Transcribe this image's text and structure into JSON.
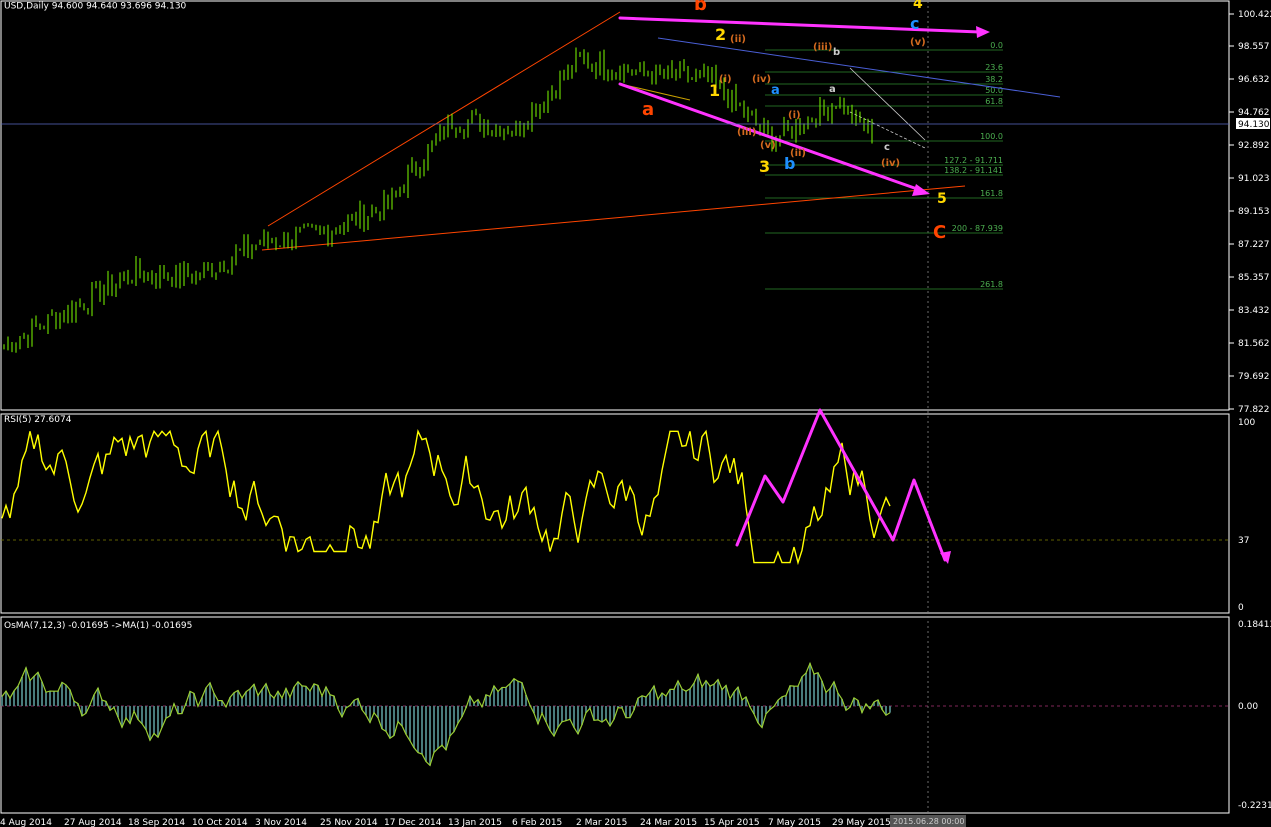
{
  "header": {
    "main": "USD,Daily  94.600  94.640  93.696  94.130",
    "rsi": "RSI(5) 27.6074",
    "osma": "OsMA(7,12,3) -0.01695  ->MA(1) -0.01695"
  },
  "colors": {
    "bg": "#000000",
    "frame": "#ffffff",
    "price": "#7cfc00",
    "rsi": "#ffff00",
    "osma_line": "#9acd32",
    "osma_hist": "#4a7c7c",
    "arrows": "#ff33ff",
    "trendline": "#ff4500",
    "channel": "#4a5fd6",
    "fib": "#2e8b2e",
    "wave_red": "#ff4500",
    "wave_yellow": "#ffd700",
    "wave_blue": "#1e90ff",
    "wave_orange": "#d2691e"
  },
  "price_axis": [
    "100.422",
    "98.557",
    "96.632",
    "94.762",
    "92.892",
    "91.023",
    "89.153",
    "87.227",
    "85.357",
    "83.432",
    "81.562",
    "79.692",
    "77.822"
  ],
  "current_price": "94.130",
  "rsi_axis": [
    "100",
    "37",
    "0"
  ],
  "osma_axis": [
    "0.18413",
    "0.00",
    "-0.22313"
  ],
  "date_axis": [
    "4 Aug 2014",
    "27 Aug 2014",
    "18 Sep 2014",
    "10 Oct 2014",
    "3 Nov 2014",
    "25 Nov 2014",
    "17 Dec 2014",
    "13 Jan 2015",
    "6 Feb 2015",
    "2 Mar 2015",
    "24 Mar 2015",
    "15 Apr 2015",
    "7 May 2015",
    "29 May 2015"
  ],
  "date_cursor": "2015.06.28 00:00",
  "fib_labels": [
    "0.0",
    "23.6",
    "38.2",
    "50.0",
    "61.8",
    "100.0",
    "127.2 - 91.711",
    "138.2 - 91.141",
    "161.8",
    "200 - 87.939",
    "261.8"
  ],
  "wave_labels": {
    "big_a": "a",
    "big_b": "b",
    "big_c": "C",
    "w1": "1",
    "w2": "2",
    "w3": "3",
    "w4": "4",
    "w5": "5",
    "blue_a": "a",
    "blue_b": "b",
    "blue_c": "c",
    "r_i": "(i)",
    "r_ii": "(ii)",
    "r_iii": "(iii)",
    "r_iv": "(iv)",
    "r_v": "(v)",
    "r_i2": "(i)",
    "r_ii2": "(ii)",
    "r_iii2": "(iii)",
    "r_iv2": "(iv)",
    "r_v2": "(v)",
    "small_a": "a",
    "small_b": "b",
    "small_c": "c"
  },
  "chart_data": {
    "type": "line",
    "title": "USD,Daily  94.600  94.640  93.696  94.130",
    "x": [
      "4 Aug 2014",
      "27 Aug 2014",
      "18 Sep 2014",
      "10 Oct 2014",
      "3 Nov 2014",
      "25 Nov 2014",
      "17 Dec 2014",
      "13 Jan 2015",
      "6 Feb 2015",
      "2 Mar 2015",
      "24 Mar 2015",
      "15 Apr 2015",
      "7 May 2015",
      "29 May 2015"
    ],
    "series": [
      {
        "values": [
          81.5,
          83.6,
          85.8,
          85.6,
          87.6,
          88.2,
          89.8,
          94.8,
          94.3,
          98.3,
          97.5,
          97.2,
          93.6,
          95.8
        ]
      }
    ],
    "ylim": [
      77.822,
      101.0
    ],
    "xlabel": "",
    "ylabel": ""
  }
}
